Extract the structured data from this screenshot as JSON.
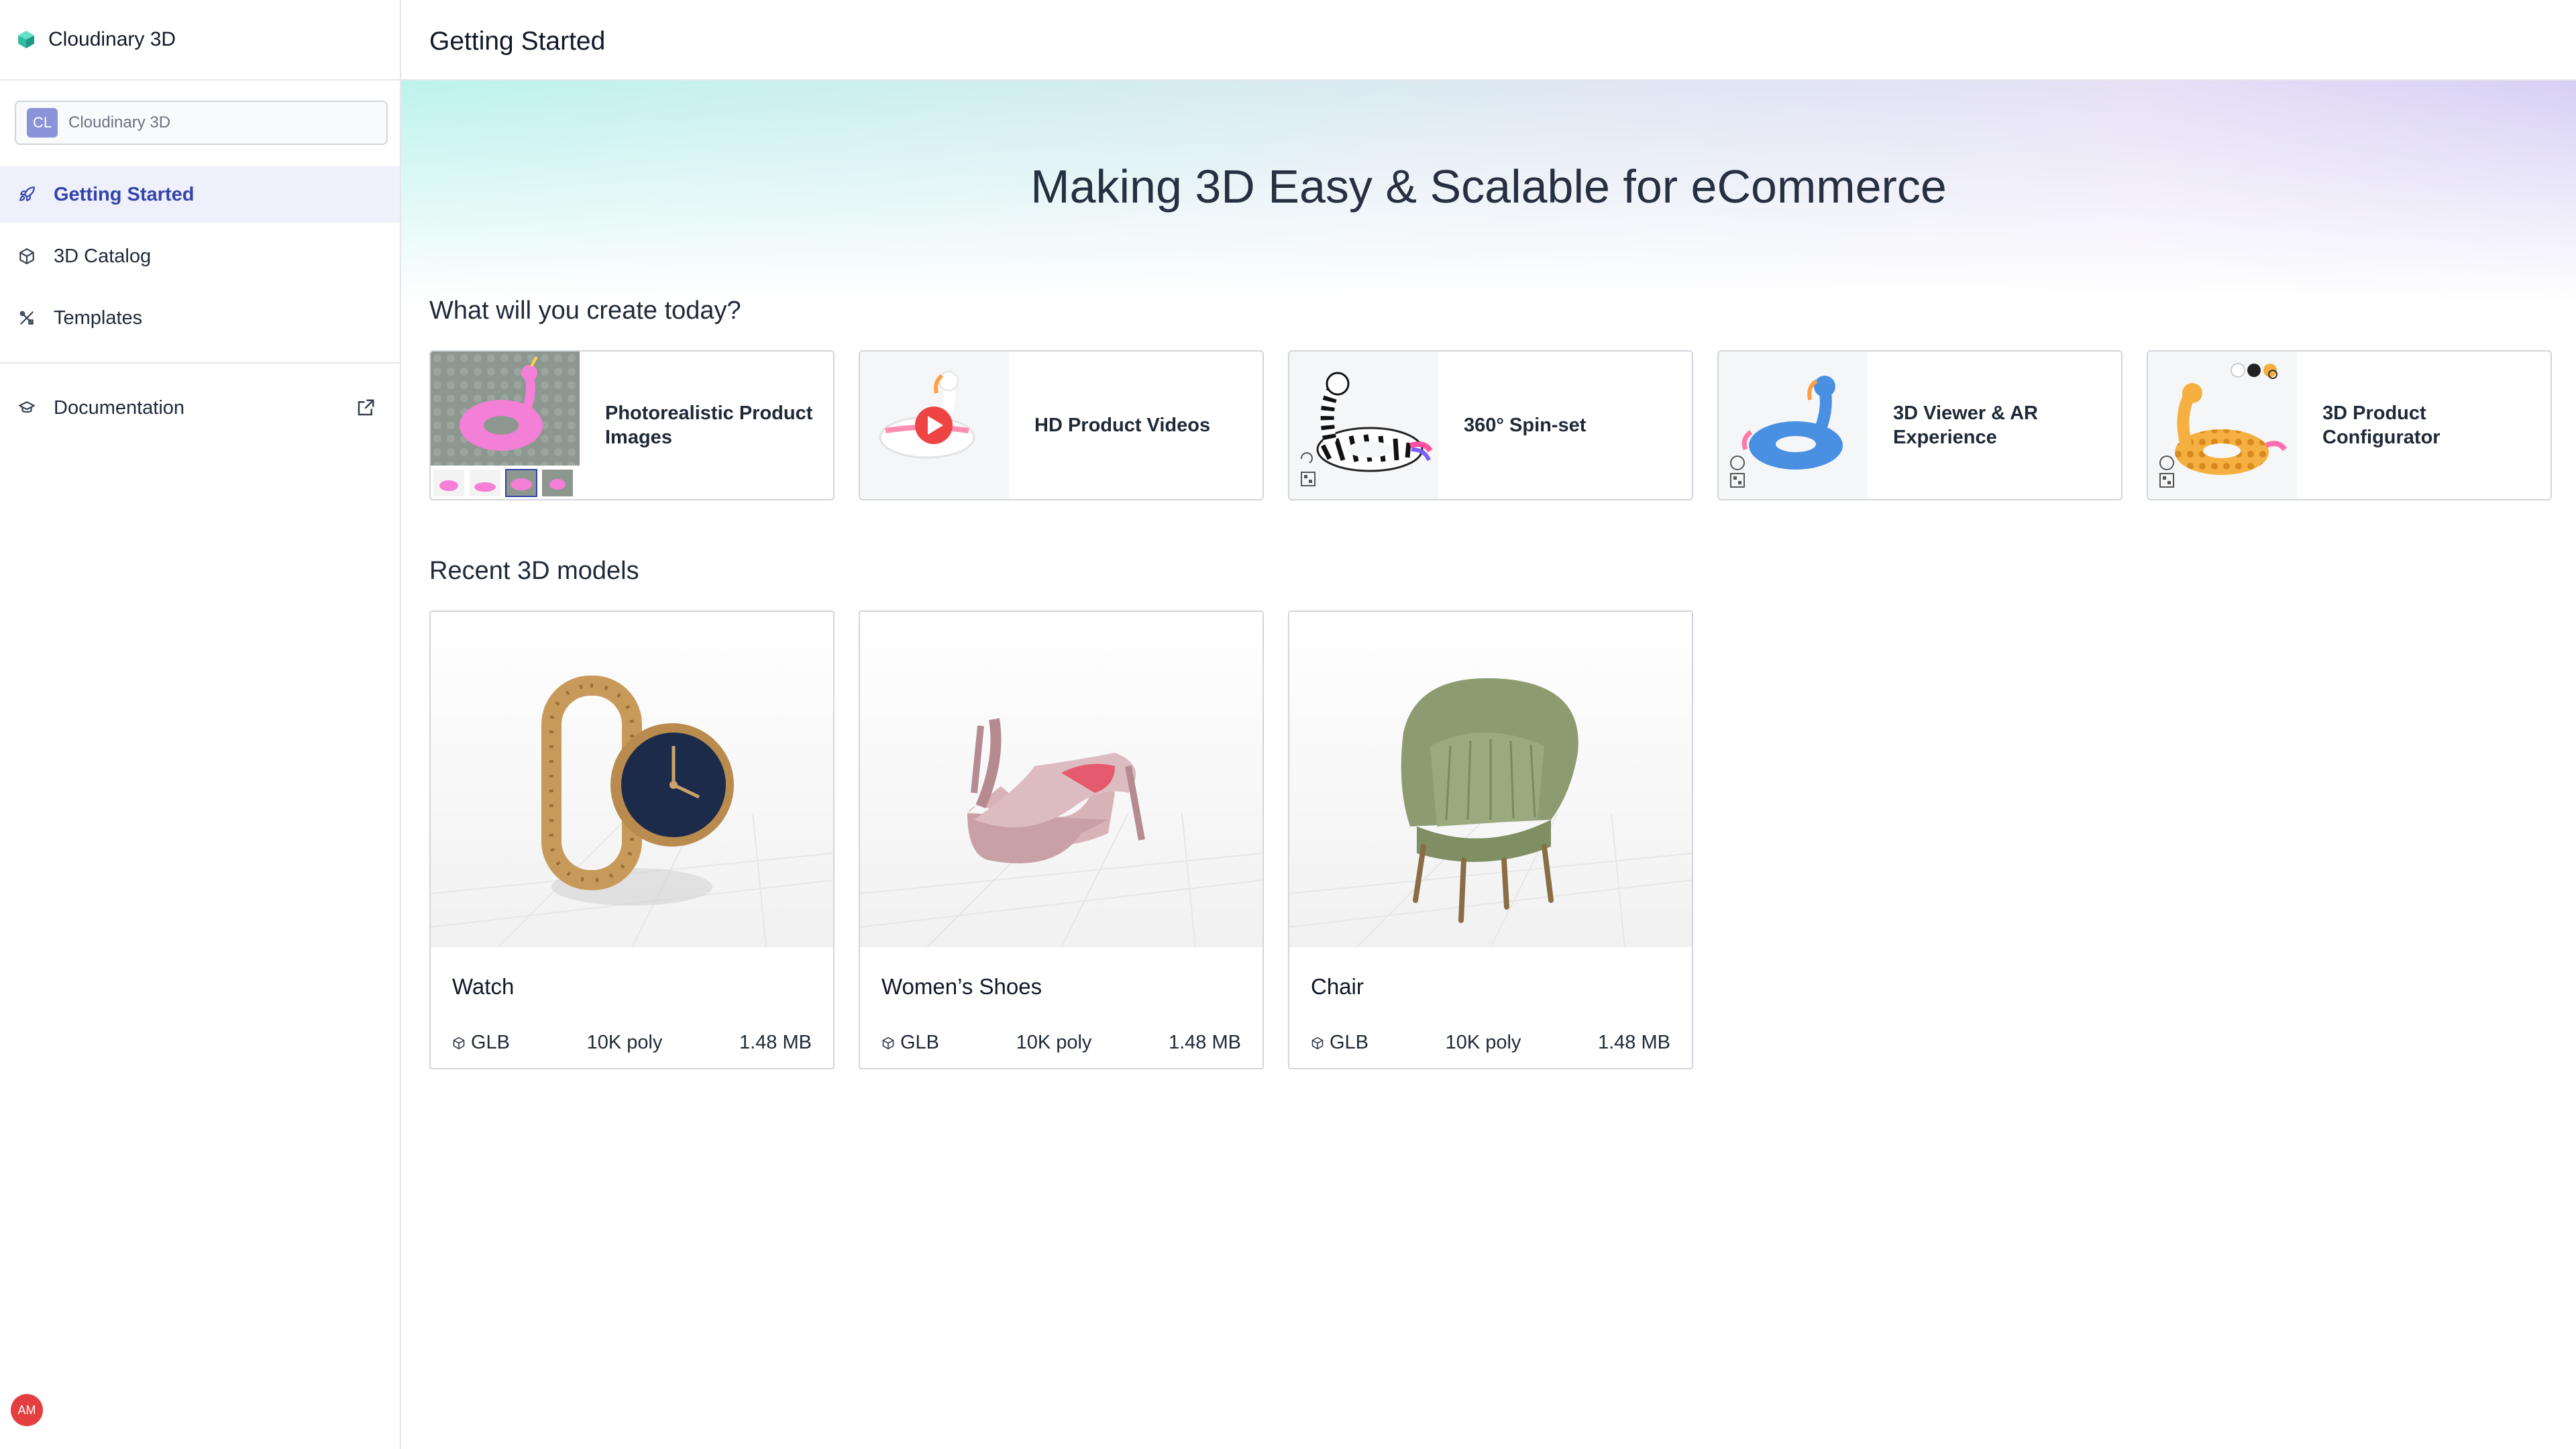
{
  "app": {
    "name": "Cloudinary 3D",
    "workspace": {
      "initials": "CL",
      "name": "Cloudinary 3D"
    },
    "user_initials": "AM"
  },
  "sidebar": {
    "items": [
      {
        "label": "Getting Started",
        "icon": "rocket-icon",
        "active": true
      },
      {
        "label": "3D Catalog",
        "icon": "cube-icon",
        "active": false
      },
      {
        "label": "Templates",
        "icon": "tools-icon",
        "active": false
      }
    ],
    "docs": {
      "label": "Documentation",
      "icon": "graduation-cap-icon",
      "external_icon": "external-link-icon"
    }
  },
  "header": {
    "title": "Getting Started"
  },
  "hero": {
    "title": "Making 3D Easy & Scalable for eCommerce"
  },
  "create": {
    "title": "What will you create today?",
    "cards": [
      {
        "label": "Photorealistic Product Images"
      },
      {
        "label": "HD Product Videos"
      },
      {
        "label": "360° Spin-set"
      },
      {
        "label": "3D Viewer & AR Experience"
      },
      {
        "label": "3D Product Configurator"
      }
    ]
  },
  "recent": {
    "title": "Recent 3D models",
    "models": [
      {
        "name": "Watch",
        "format": "GLB",
        "poly": "10K poly",
        "size": "1.48 MB"
      },
      {
        "name": "Women’s Shoes",
        "format": "GLB",
        "poly": "10K poly",
        "size": "1.48 MB"
      },
      {
        "name": "Chair",
        "format": "GLB",
        "poly": "10K poly",
        "size": "1.48 MB"
      }
    ]
  },
  "colors": {
    "accent": "#3344aa",
    "active_bg": "#eef0fb",
    "avatar": "#e53e3e",
    "workspace_badge": "#8b93d9"
  }
}
